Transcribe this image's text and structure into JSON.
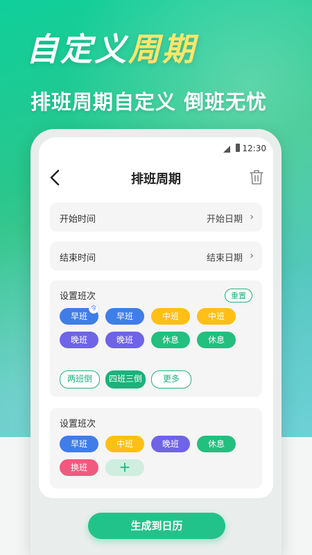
{
  "hero": {
    "title_white": "自定义",
    "title_accent": "周期",
    "subtitle": "排班周期自定义 倒班无忧"
  },
  "status_bar": {
    "time": "12:30"
  },
  "nav": {
    "title": "排班周期"
  },
  "rows": [
    {
      "label": "开始时间",
      "value": "开始日期"
    },
    {
      "label": "结束时间",
      "value": "结束日期"
    }
  ],
  "section1": {
    "title": "设置班次",
    "reset_label": "重置",
    "shifts": [
      {
        "label": "早班",
        "color": "#3f7de8"
      },
      {
        "label": "早班",
        "color": "#3f7de8"
      },
      {
        "label": "中班",
        "color": "#ffbf16"
      },
      {
        "label": "中班",
        "color": "#ffbf16"
      },
      {
        "label": "晚班",
        "color": "#6f63e8"
      },
      {
        "label": "晚班",
        "color": "#6f63e8"
      },
      {
        "label": "休息",
        "color": "#22bf7f"
      },
      {
        "label": "休息",
        "color": "#22bf7f"
      }
    ],
    "badge": "今",
    "patterns": [
      "两班倒",
      "四班三倒",
      "更多"
    ]
  },
  "section2": {
    "title": "设置班次",
    "shifts": [
      {
        "label": "早班",
        "color": "#3f7de8"
      },
      {
        "label": "中班",
        "color": "#ffbf16"
      },
      {
        "label": "晚班",
        "color": "#6f63e8"
      },
      {
        "label": "休息",
        "color": "#22bf7f"
      },
      {
        "label": "换班",
        "color": "#f05a7f"
      }
    ],
    "add_label": "+"
  },
  "generate_button": "生成到日历",
  "colors": {
    "brand": "#1bb27b",
    "accent": "#ffe66a"
  }
}
